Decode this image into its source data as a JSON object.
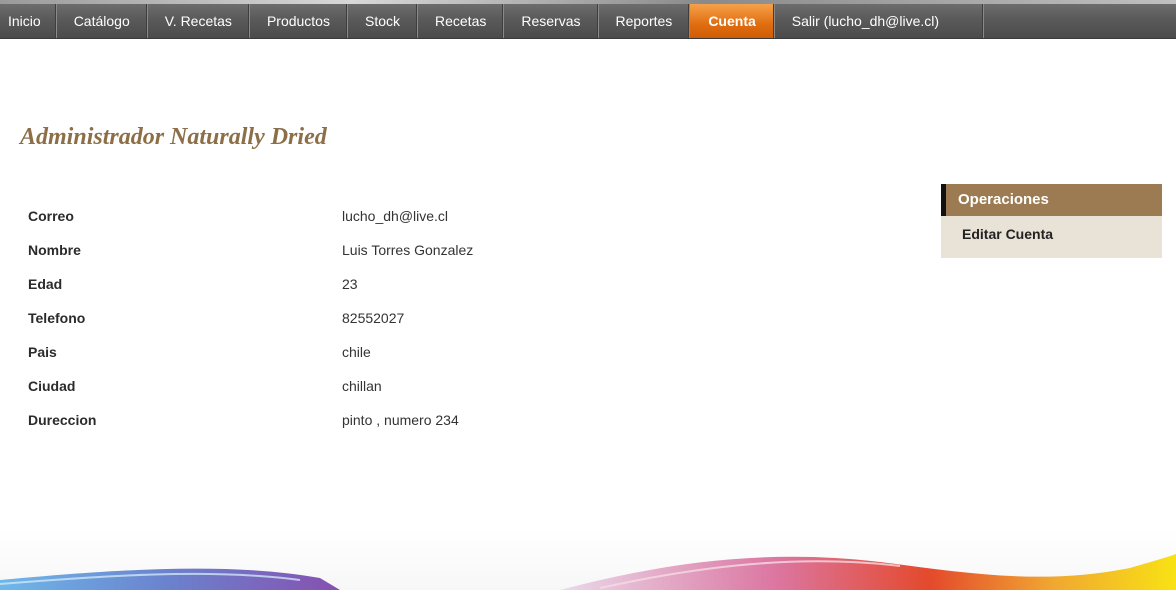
{
  "nav": {
    "items": [
      {
        "label": "Inicio"
      },
      {
        "label": "Catálogo"
      },
      {
        "label": "V. Recetas"
      },
      {
        "label": "Productos"
      },
      {
        "label": "Stock"
      },
      {
        "label": "Recetas"
      },
      {
        "label": "Reservas"
      },
      {
        "label": "Reportes"
      },
      {
        "label": "Cuenta"
      },
      {
        "label": "Salir (lucho_dh@live.cl)"
      }
    ],
    "active": "Cuenta",
    "active_color": "#e8761a"
  },
  "page": {
    "title": "Administrador Naturally Dried"
  },
  "account": {
    "fields": [
      {
        "label": "Correo",
        "value": "lucho_dh@live.cl"
      },
      {
        "label": "Nombre",
        "value": "Luis Torres Gonzalez"
      },
      {
        "label": "Edad",
        "value": "23"
      },
      {
        "label": "Telefono",
        "value": "82552027"
      },
      {
        "label": "Pais",
        "value": "chile"
      },
      {
        "label": "Ciudad",
        "value": "chillan"
      },
      {
        "label": "Dureccion",
        "value": "pinto , numero 234"
      }
    ]
  },
  "operations": {
    "header": "Operaciones",
    "items": [
      {
        "label": "Editar Cuenta"
      }
    ]
  },
  "colors": {
    "title": "#8c6e47",
    "ops_header_bg": "#9c7b52",
    "ops_item_bg": "#e8e2d7"
  }
}
